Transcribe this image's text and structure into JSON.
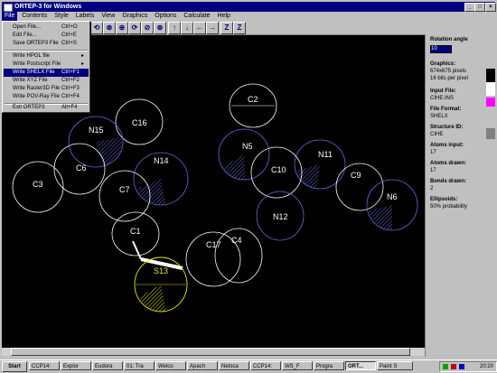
{
  "window": {
    "title": "ORTEP-3 for Windows"
  },
  "menubar": [
    "File",
    "Contents",
    "Style",
    "Labels",
    "View",
    "Graphics",
    "Options",
    "Calculate",
    "Help"
  ],
  "file_menu": [
    {
      "label": "Open File...",
      "shortcut": "Ctrl+O"
    },
    {
      "label": "Edit File...",
      "shortcut": "Ctrl+E"
    },
    {
      "label": "Save ORTEP3 File",
      "shortcut": "Ctrl+S"
    },
    {
      "label": "Write HPGL file",
      "shortcut": "",
      "submenu": true
    },
    {
      "label": "Write Postscript File",
      "shortcut": "",
      "submenu": true
    },
    {
      "label": "Write SHELX File",
      "shortcut": "Ctrl+F1"
    },
    {
      "label": "Write XYZ File",
      "shortcut": "Ctrl+F2"
    },
    {
      "label": "Write Raster3D File",
      "shortcut": "Ctrl+F3"
    },
    {
      "label": "Write POV-Ray File",
      "shortcut": "Ctrl+F4"
    },
    {
      "label": "Exit ORTEP3",
      "shortcut": "Alt+F4"
    }
  ],
  "toolbar_icons": [
    "rotate-x-icon",
    "rotate-y-icon",
    "rotate-z-icon",
    "rotate-xy-icon",
    "rotate-yz-icon",
    "rotate-xz-icon",
    "arrow-up-icon",
    "arrow-down-icon",
    "arrow-left-icon",
    "arrow-right-icon",
    "zoom-in-icon",
    "zoom-out-icon"
  ],
  "panel": {
    "rotation_label": "Rotation angle",
    "rotation_value": "10",
    "graphics_label": "Graphics:",
    "graphics_size": "674x675 pixels",
    "graphics_depth": "16 bits per pixel",
    "input_label": "Input File:",
    "input_value": "CIHE.INS",
    "format_label": "File Format:",
    "format_value": "SHELX",
    "structure_label": "Structure ID:",
    "structure_value": "CIHE",
    "atoms_input_label": "Atoms input:",
    "atoms_input_value": "17",
    "atoms_drawn_label": "Atoms drawn:",
    "atoms_drawn_value": "17",
    "bonds_label": "Bonds drawn:",
    "bonds_value": "2",
    "ellipsoids_label": "Ellipsoids:",
    "ellipsoids_value": "50% probability"
  },
  "atoms": [
    {
      "label": "C2",
      "color": "#ffffff"
    },
    {
      "label": "C16",
      "color": "#ffffff"
    },
    {
      "label": "N15",
      "color": "#6b6bd6"
    },
    {
      "label": "N5",
      "color": "#6b6bd6"
    },
    {
      "label": "N11",
      "color": "#6b6bd6"
    },
    {
      "label": "C6",
      "color": "#ffffff"
    },
    {
      "label": "N14",
      "color": "#6b6bd6"
    },
    {
      "label": "C10",
      "color": "#ffffff"
    },
    {
      "label": "C9",
      "color": "#ffffff"
    },
    {
      "label": "C3",
      "color": "#ffffff"
    },
    {
      "label": "C7",
      "color": "#ffffff"
    },
    {
      "label": "N6",
      "color": "#6b6bd6"
    },
    {
      "label": "N12",
      "color": "#6b6bd6"
    },
    {
      "label": "C1",
      "color": "#ffffff"
    },
    {
      "label": "C17",
      "color": "#ffffff"
    },
    {
      "label": "C4",
      "color": "#ffffff"
    },
    {
      "label": "S13",
      "color": "#e8e800"
    }
  ],
  "taskbar": {
    "start_label": "Start",
    "tasks": [
      "CCP14:",
      "Explor",
      "Eudora",
      "01: Tra",
      "Welco",
      "Apach",
      "Netsca",
      "CCP14:",
      "WS_F",
      "Progra",
      "ORT...",
      "Paint S"
    ],
    "active_task": "ORT...",
    "clock": "20:20"
  }
}
